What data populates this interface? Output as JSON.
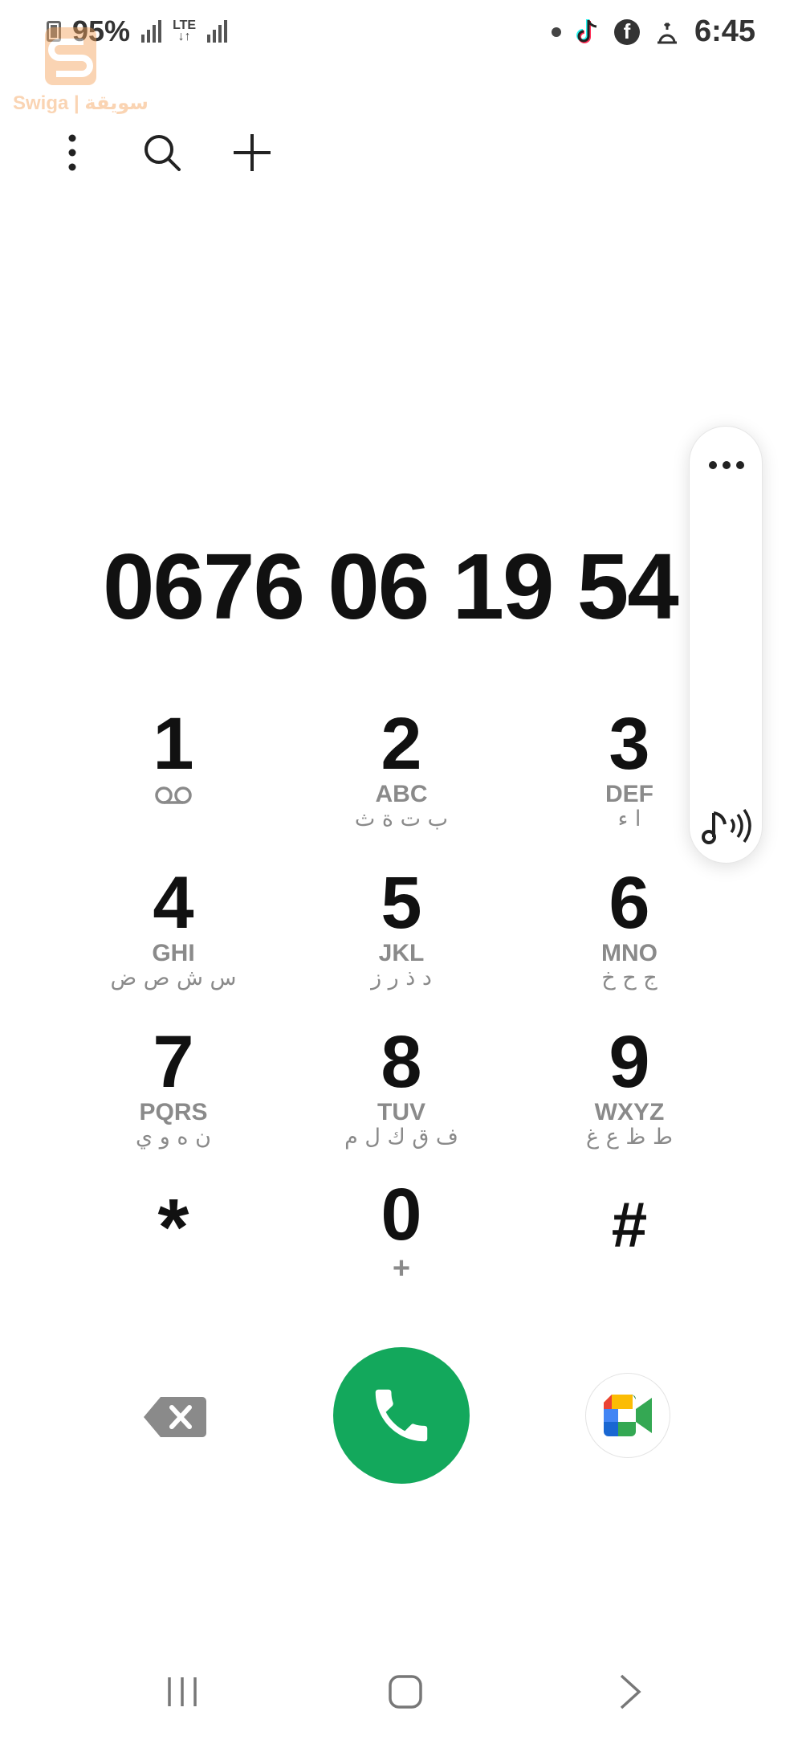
{
  "status_bar": {
    "battery_percent": "95%",
    "network_type": "LTE",
    "time": "6:45",
    "icons": [
      "battery-icon",
      "signal-icon",
      "lte-icon",
      "signal-icon",
      "notification-dot-icon",
      "tiktok-icon",
      "facebook-icon",
      "prayer-icon"
    ]
  },
  "watermark": {
    "text": "Swiga | سويقة"
  },
  "toolbar": {
    "icons": [
      "more-vert-icon",
      "search-icon",
      "add-icon"
    ]
  },
  "dialed_number": "0676 06 19 54",
  "side_panel": {
    "icons": [
      "more-horiz-icon",
      "sound-icon"
    ]
  },
  "keypad": [
    {
      "digit": "1",
      "letters": "",
      "arabic": "",
      "icon": "voicemail-icon"
    },
    {
      "digit": "2",
      "letters": "ABC",
      "arabic": "ب ت ة ث"
    },
    {
      "digit": "3",
      "letters": "DEF",
      "arabic": "ا ء"
    },
    {
      "digit": "4",
      "letters": "GHI",
      "arabic": "س ش ص ض"
    },
    {
      "digit": "5",
      "letters": "JKL",
      "arabic": "د ذ ر ز"
    },
    {
      "digit": "6",
      "letters": "MNO",
      "arabic": "ج ح خ"
    },
    {
      "digit": "7",
      "letters": "PQRS",
      "arabic": "ن ه و ي"
    },
    {
      "digit": "8",
      "letters": "TUV",
      "arabic": "ف ق ك ل م"
    },
    {
      "digit": "9",
      "letters": "WXYZ",
      "arabic": "ط ظ ع غ"
    },
    {
      "digit": "*",
      "letters": "",
      "arabic": ""
    },
    {
      "digit": "0",
      "letters": "+",
      "arabic": ""
    },
    {
      "digit": "#",
      "letters": "",
      "arabic": ""
    }
  ],
  "actions": {
    "icons": [
      "backspace-icon",
      "phone-icon",
      "google-meet-icon"
    ],
    "call_color": "#13a85c"
  },
  "nav_bar": {
    "icons": [
      "recents-icon",
      "home-icon",
      "back-icon"
    ]
  }
}
